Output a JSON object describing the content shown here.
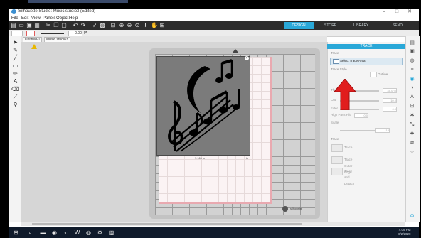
{
  "window": {
    "title": "Silhouette Studio: Music.studio3 (Edited)",
    "controls": [
      "–",
      "□",
      "✕"
    ]
  },
  "menu": [
    "File",
    "Edit",
    "View",
    "Panels",
    "Object",
    "Help"
  ],
  "nav_tabs": {
    "design": "DESIGN",
    "store": "STORE",
    "library": "LIBRARY",
    "send": "SEND"
  },
  "line_bar": {
    "width_value": "0.00",
    "unit": "pt"
  },
  "doc_tabs": [
    "Untitled-1",
    "Music.studio3"
  ],
  "mat": {
    "dim_left": "7.161 in",
    "dim_right": "in",
    "brand": "silhouette"
  },
  "trace_panel": {
    "header": "TRACE",
    "section_label": "Trace",
    "select_button": "Select Trace Area",
    "trace_style_label": "Trace Style",
    "outline_label": "Outline",
    "sliders": [
      {
        "label": "Thres",
        "value": "45.0 %"
      },
      {
        "label": "Cut",
        "value": "10.0"
      },
      {
        "label": "Filter",
        "value": "0.0"
      }
    ],
    "high_pass_label": "High Pass Filt",
    "high_pass_value": "0.0",
    "scale_label": "Scale",
    "scale_value": "10",
    "trace_label": "Trace",
    "trace_options": [
      "Trace",
      "Trace Outer Edge",
      "Trace and Detach"
    ]
  },
  "taskbar": {
    "time": "4:09 PM",
    "date": "6/2/2020"
  },
  "colors": {
    "accent": "#2aa8d8",
    "callout": "#e11d1d",
    "toolbar": "#2d2d2d",
    "taskbar": "#101b2b"
  }
}
